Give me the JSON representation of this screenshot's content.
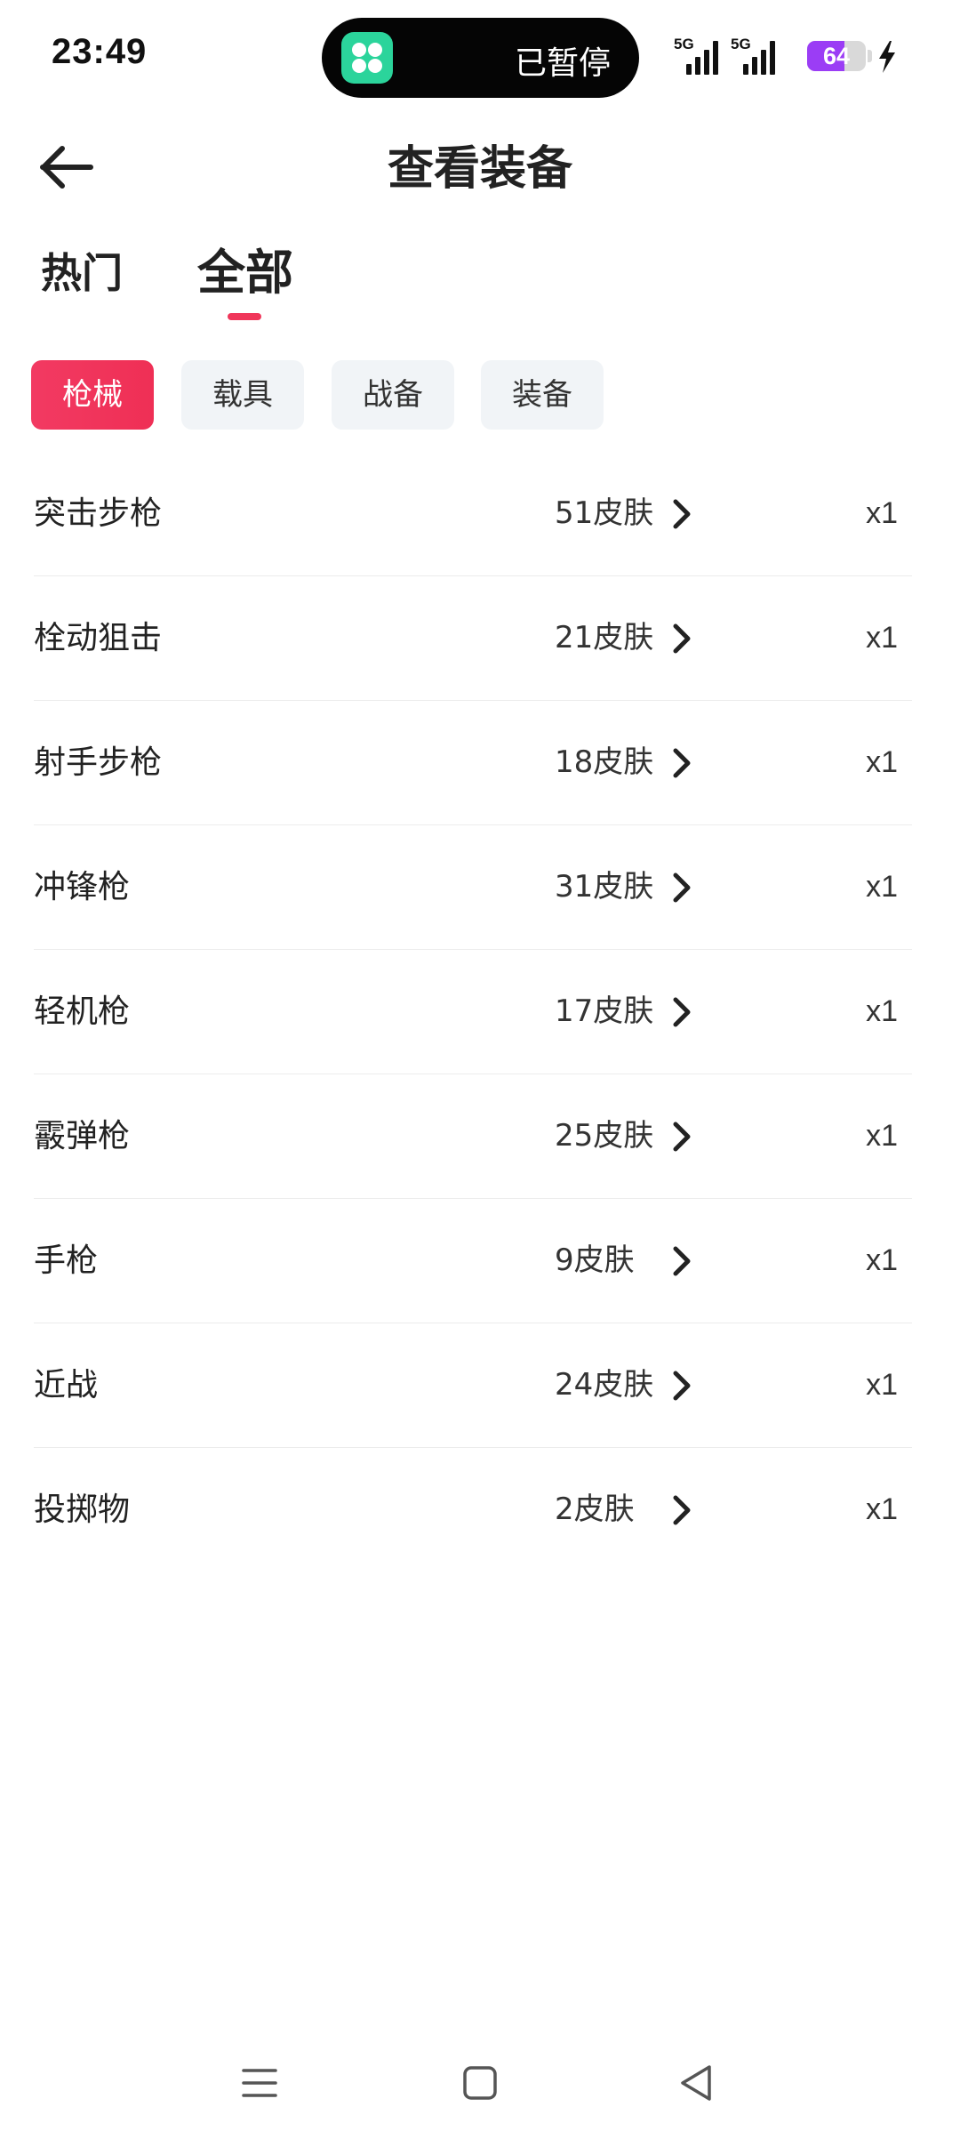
{
  "status_bar": {
    "time": "23:49",
    "island_text": "已暂停",
    "island_app_icon": "clover-app-icon",
    "network_1": "5G",
    "network_2": "5G",
    "battery_percent": "64",
    "battery_level": 0.64,
    "battery_color": "#9b3df5",
    "charging": true
  },
  "header": {
    "back_icon": "arrow-left-icon",
    "title": "查看装备"
  },
  "main_tabs": [
    {
      "label": "热门",
      "active": false
    },
    {
      "label": "全部",
      "active": true
    }
  ],
  "categories": [
    {
      "label": "枪械",
      "active": true
    },
    {
      "label": "载具",
      "active": false
    },
    {
      "label": "战备",
      "active": false
    },
    {
      "label": "装备",
      "active": false
    }
  ],
  "weapons": [
    {
      "name": "突击步枪",
      "skins": "51皮肤",
      "count": "x1"
    },
    {
      "name": "栓动狙击",
      "skins": "21皮肤",
      "count": "x1"
    },
    {
      "name": "射手步枪",
      "skins": "18皮肤",
      "count": "x1"
    },
    {
      "name": "冲锋枪",
      "skins": "31皮肤",
      "count": "x1"
    },
    {
      "name": "轻机枪",
      "skins": "17皮肤",
      "count": "x1"
    },
    {
      "name": "霰弹枪",
      "skins": "25皮肤",
      "count": "x1"
    },
    {
      "name": "手枪",
      "skins": "9皮肤",
      "count": "x1"
    },
    {
      "name": "近战",
      "skins": "24皮肤",
      "count": "x1"
    },
    {
      "name": "投掷物",
      "skins": "2皮肤",
      "count": "x1"
    }
  ],
  "nav_bar": {
    "menu_icon": "menu-icon",
    "home_icon": "square-home-icon",
    "back_icon": "triangle-back-icon"
  },
  "colors": {
    "accent": "#f0365a",
    "chip_bg": "#f1f4f7",
    "text": "#222222"
  }
}
